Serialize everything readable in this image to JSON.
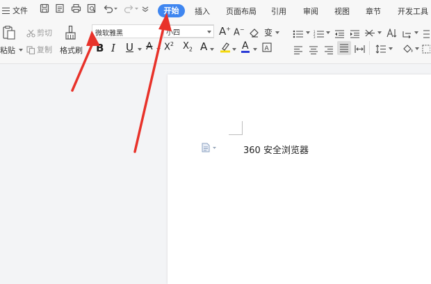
{
  "menu": {
    "file_label": "文件",
    "tabs": [
      "开始",
      "插入",
      "页面布局",
      "引用",
      "审阅",
      "视图",
      "章节",
      "开发工具"
    ],
    "active_tab_index": 0
  },
  "ribbon": {
    "paste_label": "粘贴",
    "cut_label": "剪切",
    "copy_label": "复制",
    "format_painter_label": "格式刷",
    "font_name": "微软雅黑",
    "font_size": "小四"
  },
  "document": {
    "text": "360 安全浏览器"
  },
  "colors": {
    "accent": "#3f86f0",
    "annotation_arrow": "#e8322a",
    "highlight": "#f5d90a",
    "font_color": "#2b3bd6"
  }
}
